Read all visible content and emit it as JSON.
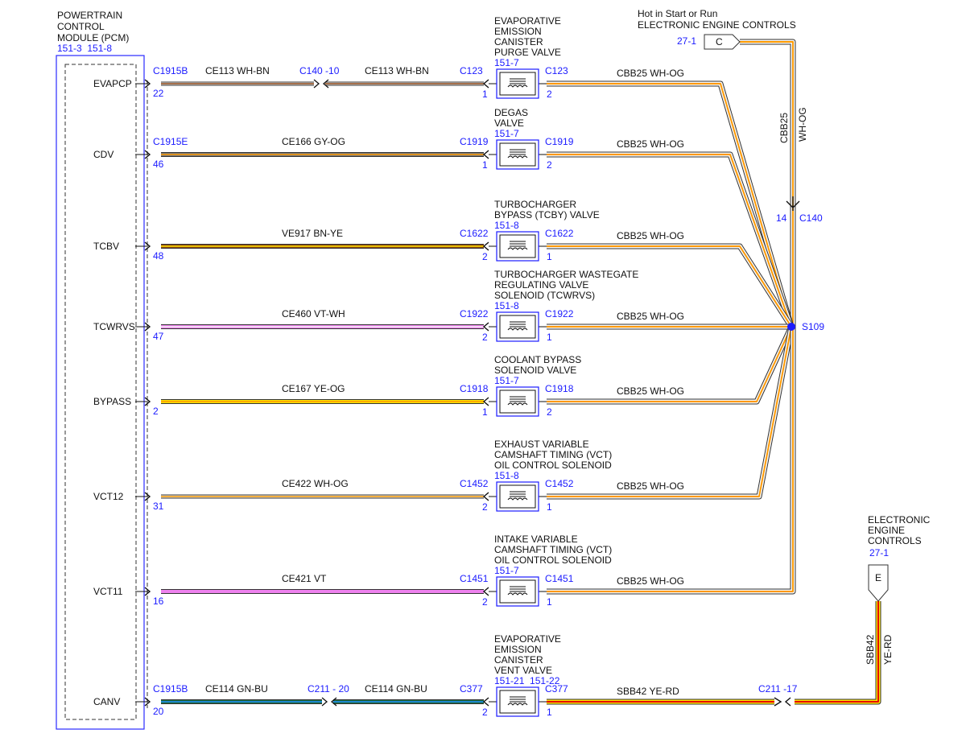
{
  "pcm": {
    "title_lines": [
      "POWERTRAIN",
      "CONTROL",
      "MODULE (PCM)"
    ],
    "refs": "151-3  151-8"
  },
  "colors": {
    "WH": "#f5f5f5",
    "BN": "#8b4513",
    "GY": "#7a7a7a",
    "OG": "#ff9900",
    "YE": "#ffe600",
    "VT": "#ee82ee",
    "GN": "#1d6b3a",
    "BU": "#1e90ff",
    "RD": "#e60000",
    "outline": "#333333",
    "blue_text": "#1a1aff"
  },
  "circuits": [
    {
      "pin_name": "EVAPCP",
      "pcm_connector": "C1915B",
      "pcm_pin": "22",
      "inline": {
        "connector": "C140",
        "pin": "-10"
      },
      "wire1": {
        "circuit": "CE113",
        "color": "WH-BN"
      },
      "wire1b": {
        "circuit": "CE113",
        "color": "WH-BN"
      },
      "device": {
        "name_lines": [
          "EVAPORATIVE",
          "EMISSION",
          "CANISTER",
          "PURGE VALVE"
        ],
        "refs": "151-7",
        "left_connector": "C123",
        "left_pin": "1",
        "right_connector": "C123",
        "right_pin": "2"
      },
      "wire2": {
        "circuit": "CBB25",
        "color": "WH-OG"
      }
    },
    {
      "pin_name": "CDV",
      "pcm_connector": "C1915E",
      "pcm_pin": "46",
      "wire1": {
        "circuit": "CE166",
        "color": "GY-OG"
      },
      "device": {
        "name_lines": [
          "DEGAS",
          "VALVE"
        ],
        "refs": "151-7",
        "left_connector": "C1919",
        "left_pin": "1",
        "right_connector": "C1919",
        "right_pin": "2"
      },
      "wire2": {
        "circuit": "CBB25",
        "color": "WH-OG"
      }
    },
    {
      "pin_name": "TCBV",
      "pcm_connector": "",
      "pcm_pin": "48",
      "wire1": {
        "circuit": "VE917",
        "color": "BN-YE"
      },
      "device": {
        "name_lines": [
          "TURBOCHARGER",
          "BYPASS (TCBY) VALVE"
        ],
        "refs": "151-8",
        "left_connector": "C1622",
        "left_pin": "2",
        "right_connector": "C1622",
        "right_pin": "1"
      },
      "wire2": {
        "circuit": "CBB25",
        "color": "WH-OG"
      }
    },
    {
      "pin_name": "TCWRVS",
      "pcm_connector": "",
      "pcm_pin": "47",
      "wire1": {
        "circuit": "CE460",
        "color": "VT-WH"
      },
      "device": {
        "name_lines": [
          "TURBOCHARGER WASTEGATE",
          "REGULATING VALVE",
          "SOLENOID (TCWRVS)"
        ],
        "refs": "151-8",
        "left_connector": "C1922",
        "left_pin": "2",
        "right_connector": "C1922",
        "right_pin": "1"
      },
      "wire2": {
        "circuit": "CBB25",
        "color": "WH-OG"
      }
    },
    {
      "pin_name": "BYPASS",
      "pcm_connector": "",
      "pcm_pin": "2",
      "wire1": {
        "circuit": "CE167",
        "color": "YE-OG"
      },
      "device": {
        "name_lines": [
          "COOLANT BYPASS",
          "SOLENOID VALVE"
        ],
        "refs": "151-7",
        "left_connector": "C1918",
        "left_pin": "1",
        "right_connector": "C1918",
        "right_pin": "2"
      },
      "wire2": {
        "circuit": "CBB25",
        "color": "WH-OG"
      }
    },
    {
      "pin_name": "VCT12",
      "pcm_connector": "",
      "pcm_pin": "31",
      "wire1": {
        "circuit": "CE422",
        "color": "WH-OG"
      },
      "device": {
        "name_lines": [
          "EXHAUST VARIABLE",
          "CAMSHAFT TIMING (VCT)",
          "OIL CONTROL SOLENOID"
        ],
        "refs": "151-8",
        "left_connector": "C1452",
        "left_pin": "2",
        "right_connector": "C1452",
        "right_pin": "1"
      },
      "wire2": {
        "circuit": "CBB25",
        "color": "WH-OG"
      }
    },
    {
      "pin_name": "VCT11",
      "pcm_connector": "",
      "pcm_pin": "16",
      "wire1": {
        "circuit": "CE421",
        "color": "VT"
      },
      "device": {
        "name_lines": [
          "INTAKE VARIABLE",
          "CAMSHAFT TIMING (VCT)",
          "OIL CONTROL SOLENOID"
        ],
        "refs": "151-7",
        "left_connector": "C1451",
        "left_pin": "2",
        "right_connector": "C1451",
        "right_pin": "1"
      },
      "wire2": {
        "circuit": "CBB25",
        "color": "WH-OG"
      }
    },
    {
      "pin_name": "CANV",
      "pcm_connector": "C1915B",
      "pcm_pin": "20",
      "inline": {
        "connector": "C211",
        "pin": "- 20"
      },
      "wire1": {
        "circuit": "CE114",
        "color": "GN-BU"
      },
      "wire1b": {
        "circuit": "CE114",
        "color": "GN-BU"
      },
      "device": {
        "name_lines": [
          "EVAPORATIVE",
          "EMISSION",
          "CANISTER",
          "VENT VALVE"
        ],
        "refs": "151-21  151-22",
        "left_connector": "C377",
        "left_pin": "2",
        "right_connector": "C377",
        "right_pin": "1"
      },
      "wire2": {
        "circuit": "SBB42",
        "color": "YE-RD"
      },
      "inline2": {
        "connector": "C211",
        "pin": "-17"
      }
    }
  ],
  "power": {
    "title_lines": [
      "Hot in Start or Run",
      "ELECTRONIC ENGINE CONTROLS"
    ],
    "ref": "27-1",
    "connector_letter": "C",
    "wire": {
      "circuit": "CBB25",
      "color": "WH-OG"
    },
    "inline": {
      "connector": "C140",
      "pin": "14"
    },
    "splice": "S109"
  },
  "eec": {
    "title_lines": [
      "ELECTRONIC",
      "ENGINE",
      "CONTROLS"
    ],
    "ref": "27-1",
    "connector_letter": "E",
    "wire": {
      "circuit": "SBB42",
      "color": "YE-RD"
    }
  }
}
